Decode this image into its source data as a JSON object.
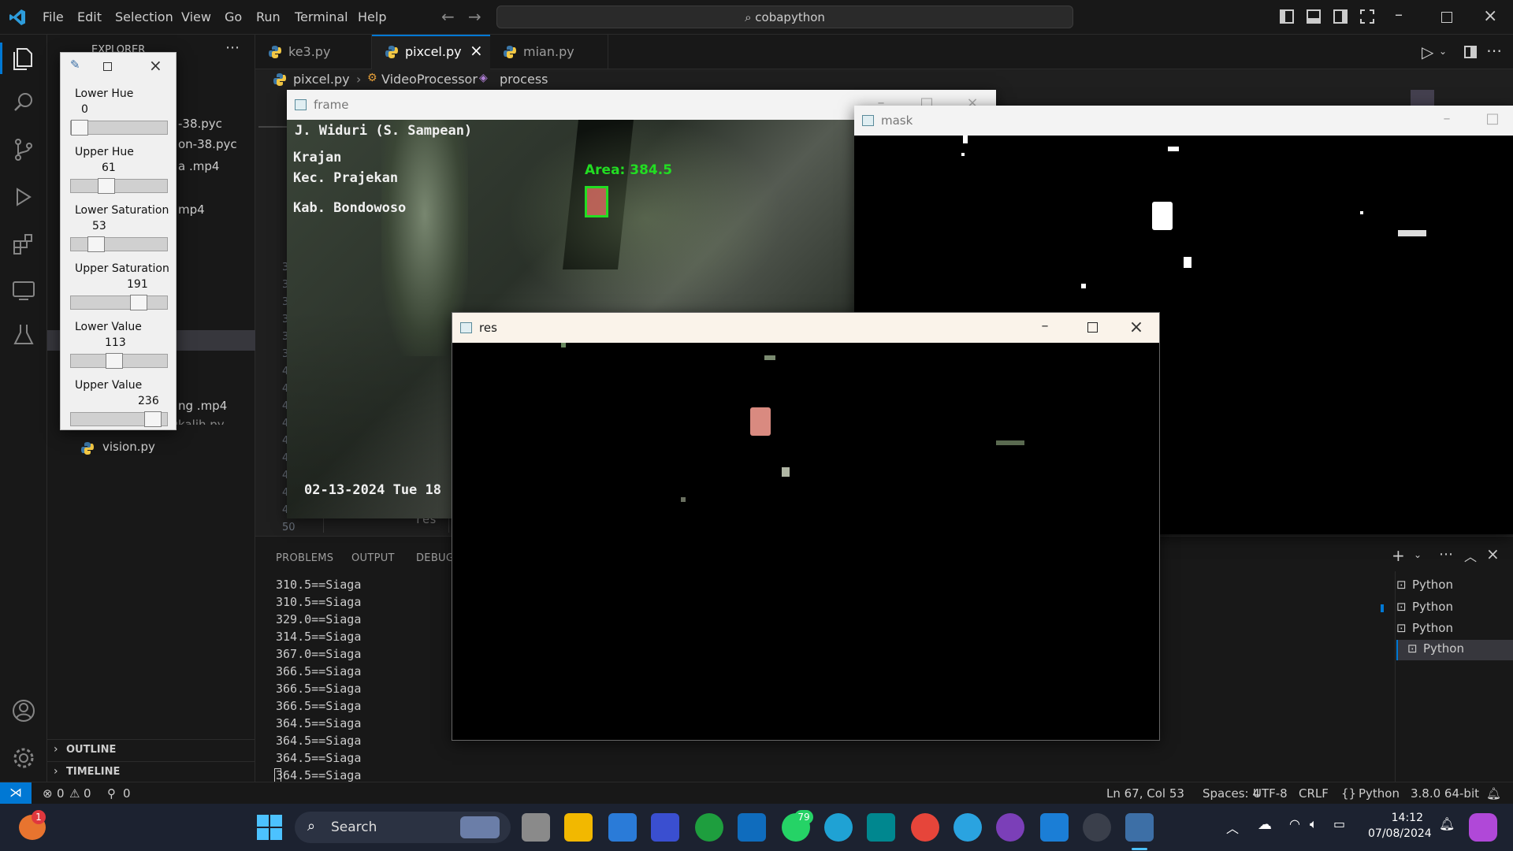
{
  "titlebar": {
    "menu": [
      "File",
      "Edit",
      "Selection",
      "View",
      "Go",
      "Run",
      "Terminal",
      "Help"
    ],
    "search": "cobapython"
  },
  "explorer": {
    "header": "EXPLORER",
    "files_partial": [
      "-38.pyc",
      "on-38.pyc",
      "a .mp4",
      "mp4",
      "ng .mp4",
      "sangkalih.py"
    ],
    "vision_file": "vision.py",
    "outline": "OUTLINE",
    "timeline": "TIMELINE"
  },
  "tabs": [
    {
      "label": "ke3.py",
      "active": false
    },
    {
      "label": "pixcel.py",
      "active": true
    },
    {
      "label": "mian.py",
      "active": false
    }
  ],
  "breadcrumb": {
    "file": "pixcel.py",
    "class": "VideoProcessor",
    "method": "process"
  },
  "editor": {
    "line_numbers": [
      "3",
      "3",
      "3",
      "3",
      "3",
      "3",
      "4",
      "4",
      "4",
      "4",
      "4",
      "4",
      "4",
      "4",
      "49",
      "50"
    ],
    "code_fragment": "res"
  },
  "panel": {
    "tabs": [
      "PROBLEMS",
      "OUTPUT",
      "DEBUG"
    ],
    "terminal_lines": [
      "310.5==Siaga",
      "310.5==Siaga",
      "329.0==Siaga",
      "314.5==Siaga",
      "367.0==Siaga",
      "366.5==Siaga",
      "366.5==Siaga",
      "366.5==Siaga",
      "364.5==Siaga",
      "364.5==Siaga",
      "364.5==Siaga",
      "364.5==Siaga"
    ],
    "terminals": [
      "Python",
      "Python",
      "Python",
      "Python"
    ]
  },
  "statusbar": {
    "errors": "0",
    "warnings": "0",
    "ports": "0",
    "position": "Ln 67, Col 53",
    "spaces": "Spaces: 4",
    "encoding": "UTF-8",
    "eol": "CRLF",
    "language": "Python",
    "interpreter": "3.8.0 64-bit"
  },
  "trackbars": [
    {
      "label": "Lower Hue",
      "value": "0",
      "level": 0.0
    },
    {
      "label": "Upper Hue",
      "value": "61",
      "level": 0.34
    },
    {
      "label": "Lower Saturation",
      "value": "53",
      "level": 0.21
    },
    {
      "label": "Upper Saturation",
      "value": "191",
      "level": 0.75
    },
    {
      "label": "Lower Value",
      "value": "113",
      "level": 0.44
    },
    {
      "label": "Upper Value",
      "value": "236",
      "level": 0.93
    }
  ],
  "frame_window": {
    "title": "frame",
    "overlay_lines": [
      "J. Widuri (S. Sampean)",
      "Krajan",
      "Kec. Prajekan",
      "Kab. Bondowoso"
    ],
    "area_label": "Area: 384.5",
    "timestamp": "02-13-2024 Tue 18"
  },
  "mask_window": {
    "title": "mask"
  },
  "res_window": {
    "title": "res"
  },
  "taskbar": {
    "search": "Search",
    "time": "14:12",
    "date": "07/08/2024",
    "badges": {
      "whatsapp": "79",
      "firefox": "1"
    }
  },
  "colors": {
    "accent": "#0078d4",
    "area_text": "#22dd22",
    "statusbar_remote": "#0078d4"
  }
}
